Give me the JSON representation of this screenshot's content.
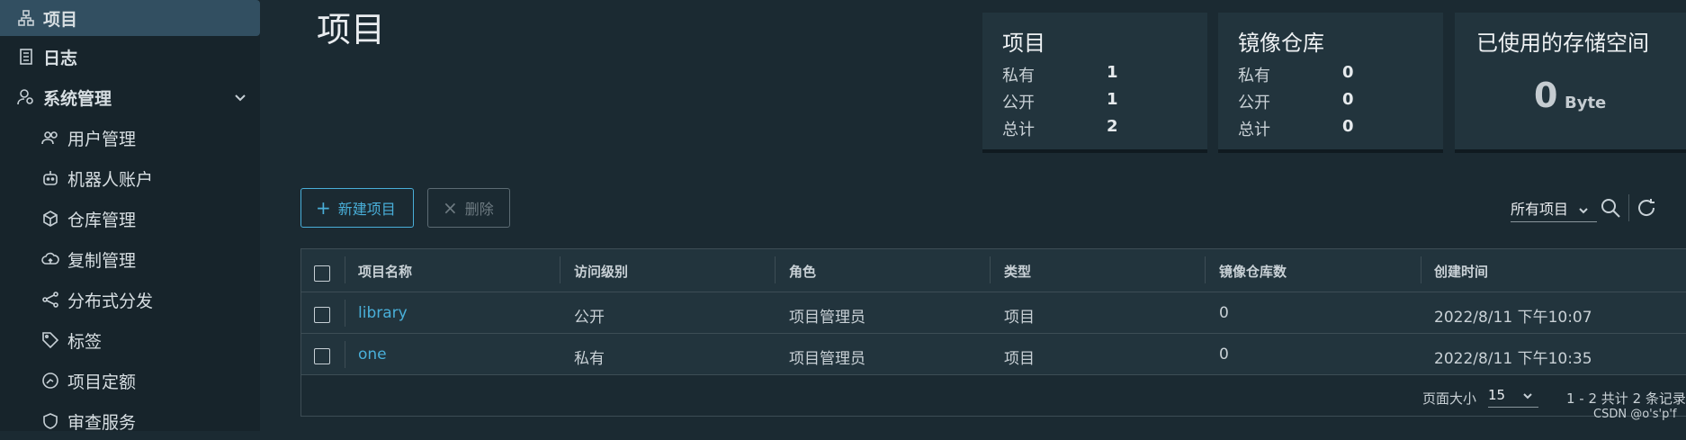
{
  "sidebar": {
    "items": [
      {
        "label": "项目",
        "icon": "project-icon",
        "active": true
      },
      {
        "label": "日志",
        "icon": "log-icon"
      },
      {
        "label": "系统管理",
        "icon": "admin-icon",
        "expanded": true
      },
      {
        "label": "用户管理",
        "icon": "users-icon"
      },
      {
        "label": "机器人账户",
        "icon": "robot-icon"
      },
      {
        "label": "仓库管理",
        "icon": "registry-icon"
      },
      {
        "label": "复制管理",
        "icon": "replication-icon"
      },
      {
        "label": "分布式分发",
        "icon": "distribution-icon"
      },
      {
        "label": "标签",
        "icon": "tag-icon"
      },
      {
        "label": "项目定额",
        "icon": "quota-icon"
      },
      {
        "label": "审查服务",
        "icon": "shield-icon"
      }
    ]
  },
  "page": {
    "title": "项目"
  },
  "cards": {
    "projects": {
      "title": "项目",
      "rows": [
        {
          "label": "私有",
          "value": "1"
        },
        {
          "label": "公开",
          "value": "1"
        },
        {
          "label": "总计",
          "value": "2"
        }
      ]
    },
    "repos": {
      "title": "镜像仓库",
      "rows": [
        {
          "label": "私有",
          "value": "0"
        },
        {
          "label": "公开",
          "value": "0"
        },
        {
          "label": "总计",
          "value": "0"
        }
      ]
    },
    "storage": {
      "title": "已使用的存储空间",
      "value": "0",
      "unit": "Byte"
    }
  },
  "toolbar": {
    "new_label": "新建项目",
    "delete_label": "删除",
    "filter_value": "所有项目"
  },
  "table": {
    "headers": [
      "项目名称",
      "访问级别",
      "角色",
      "类型",
      "镜像仓库数",
      "创建时间"
    ],
    "rows": [
      {
        "name": "library",
        "access": "公开",
        "role": "项目管理员",
        "type": "项目",
        "repos": "0",
        "created": "2022/8/11 下午10:07"
      },
      {
        "name": "one",
        "access": "私有",
        "role": "项目管理员",
        "type": "项目",
        "repos": "0",
        "created": "2022/8/11 下午10:35"
      }
    ],
    "footer": {
      "page_size_label": "页面大小",
      "page_size": "15",
      "summary": "1 - 2 共计 2 条记录"
    }
  },
  "watermark": "CSDN @o's'p'f"
}
